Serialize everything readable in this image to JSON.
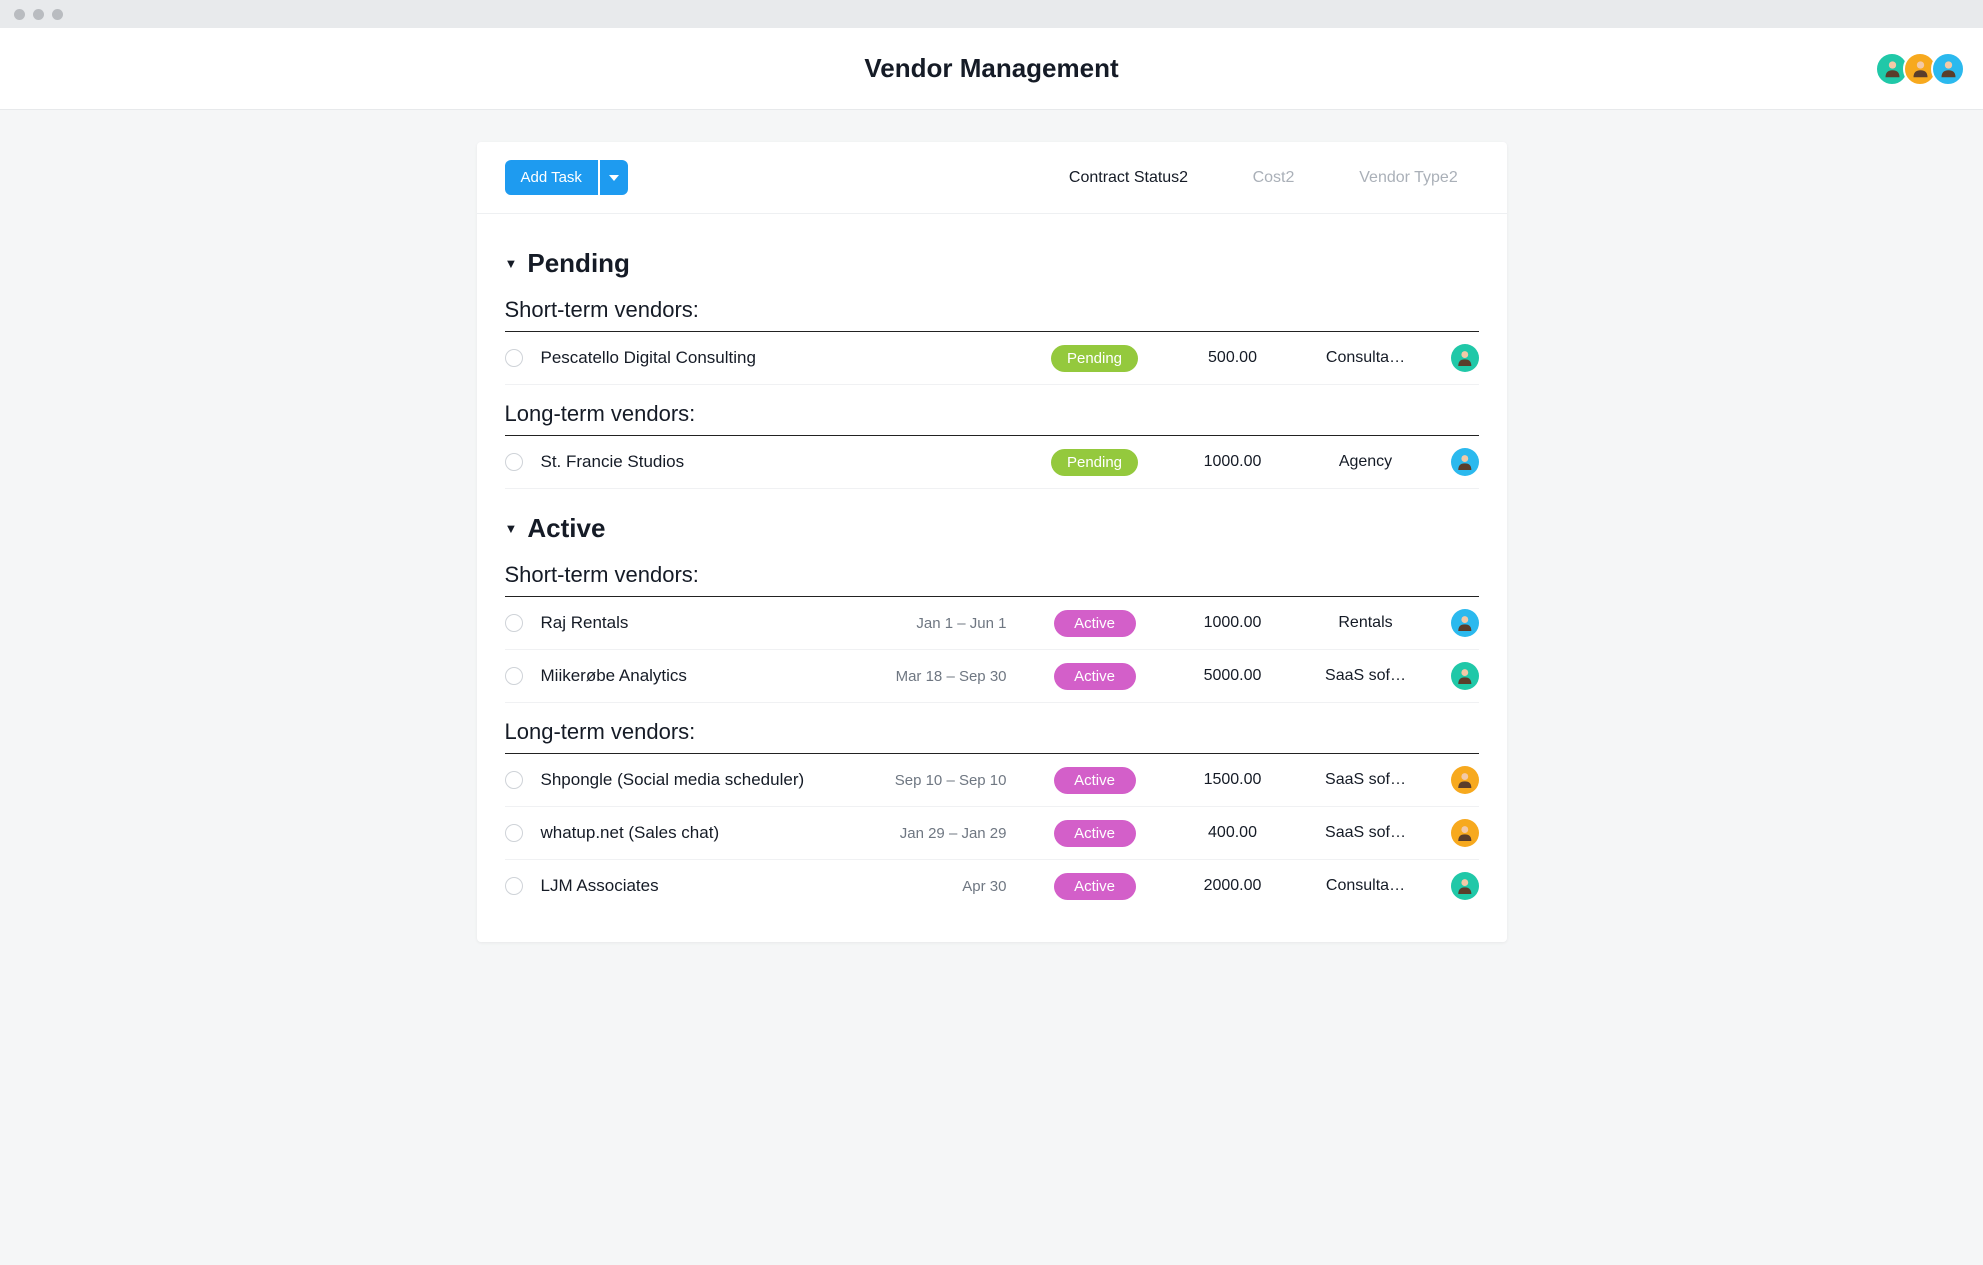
{
  "header": {
    "title": "Vendor Management"
  },
  "header_avatars": [
    {
      "color": "teal"
    },
    {
      "color": "orange"
    },
    {
      "color": "blue"
    }
  ],
  "toolbar": {
    "add_task_label": "Add Task"
  },
  "columns": {
    "status": "Contract Status2",
    "cost": "Cost2",
    "vendor_type": "Vendor Type2"
  },
  "sections": [
    {
      "title": "Pending",
      "groups": [
        {
          "label": "Short-term vendors:",
          "rows": [
            {
              "name": "Pescatello Digital Consulting",
              "date": "",
              "status": "Pending",
              "status_kind": "pending",
              "cost": "500.00",
              "vendor_type": "Consulta…",
              "avatar_color": "teal"
            }
          ]
        },
        {
          "label": "Long-term vendors:",
          "rows": [
            {
              "name": "St. Francie Studios",
              "date": "",
              "status": "Pending",
              "status_kind": "pending",
              "cost": "1000.00",
              "vendor_type": "Agency",
              "avatar_color": "blue"
            }
          ]
        }
      ]
    },
    {
      "title": "Active",
      "groups": [
        {
          "label": "Short-term vendors:",
          "rows": [
            {
              "name": "Raj Rentals",
              "date": "Jan 1 – Jun 1",
              "status": "Active",
              "status_kind": "active",
              "cost": "1000.00",
              "vendor_type": "Rentals",
              "avatar_color": "blue"
            },
            {
              "name": "Miikerøbe Analytics",
              "date": "Mar 18 – Sep 30",
              "status": "Active",
              "status_kind": "active",
              "cost": "5000.00",
              "vendor_type": "SaaS sof…",
              "avatar_color": "teal"
            }
          ]
        },
        {
          "label": "Long-term vendors:",
          "rows": [
            {
              "name": "Shpongle (Social media scheduler)",
              "date": "Sep 10 – Sep 10",
              "status": "Active",
              "status_kind": "active",
              "cost": "1500.00",
              "vendor_type": "SaaS sof…",
              "avatar_color": "orange"
            },
            {
              "name": "whatup.net (Sales chat)",
              "date": "Jan 29 – Jan 29",
              "status": "Active",
              "status_kind": "active",
              "cost": "400.00",
              "vendor_type": "SaaS sof…",
              "avatar_color": "orange"
            },
            {
              "name": "LJM Associates",
              "date": "Apr 30",
              "status": "Active",
              "status_kind": "active",
              "cost": "2000.00",
              "vendor_type": "Consulta…",
              "avatar_color": "teal"
            }
          ]
        }
      ]
    }
  ]
}
